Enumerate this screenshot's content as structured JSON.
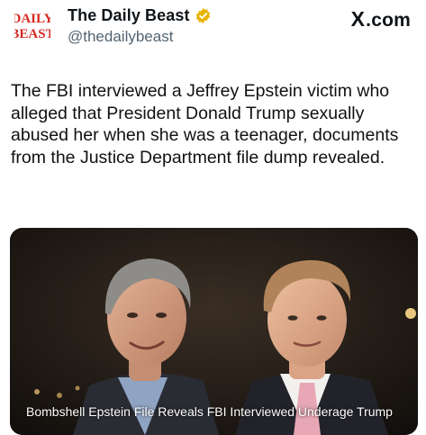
{
  "account": {
    "logo_line1": "DAILY",
    "logo_line2": "BEAST",
    "display_name": "The Daily Beast",
    "handle": "@thedailybeast",
    "verified": true
  },
  "platform": {
    "mark": "X",
    "suffix": ".com"
  },
  "post": {
    "text": "The FBI interviewed a Jeffrey Epstein victim who alleged that President Donald Trump sexually abused her when she was a teenager, documents from the Justice Department file dump revealed."
  },
  "media": {
    "caption": "Bombshell Epstein File Reveals FBI Interviewed Underage Trump"
  },
  "colors": {
    "brand_red": "#d42a23",
    "verified_gold": "#e8b400",
    "handle_gray": "#536471"
  }
}
